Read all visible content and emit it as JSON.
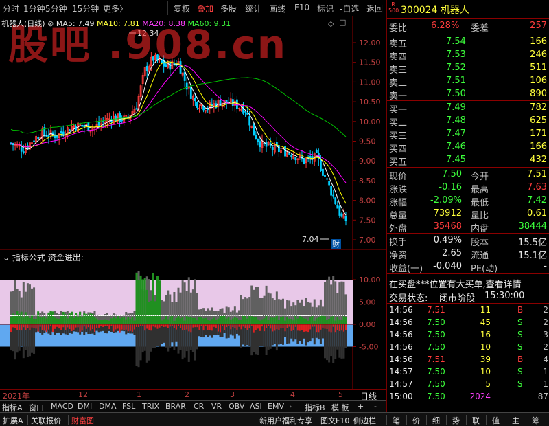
{
  "toolbar": {
    "items": [
      "分时",
      "1分钟",
      "5分钟",
      "15分钟",
      "更多〉",
      "复权",
      "叠加",
      "多股",
      "统计",
      "画线",
      "F10",
      "标记",
      "-自选",
      "返回"
    ],
    "active_index": 0
  },
  "watermark": "股吧 .908.cn",
  "main_chart": {
    "stock_label": "机器人(日线)",
    "ma5": "MA5: 7.49",
    "ma10": "MA10: 7.81",
    "ma20": "MA20: 8.38",
    "ma60": "MA60: 9.31",
    "high_label": "12.34",
    "low_label": "7.04",
    "fin_badge": "财",
    "y_ticks": [
      "12.00",
      "11.50",
      "11.00",
      "10.50",
      "10.00",
      "9.50",
      "9.00",
      "8.50",
      "8.00",
      "7.50",
      "7.00"
    ],
    "colors": {
      "ma5": "#ffffff",
      "ma10": "#ffff00",
      "ma20": "#ff00ff",
      "ma60": "#00c000",
      "up": "#ff3c3c",
      "down": "#00d0ff"
    }
  },
  "sub_chart": {
    "title": "指标公式 资金进出: -",
    "y_ticks": [
      "10.00",
      "5.00",
      "0.00",
      "-5.00"
    ]
  },
  "time_axis": [
    "2021年",
    "12",
    "1",
    "2",
    "3",
    "4",
    "5"
  ],
  "period_label": "日线",
  "indicator_tabs": [
    "指标A",
    "窗口",
    "MACD",
    "DMI",
    "DMA",
    "FSL",
    "TRIX",
    "BRAR",
    "CR",
    "VR",
    "OBV",
    "ASI",
    "EMV"
  ],
  "indicator_tabs_right": [
    "指标B",
    "模 板",
    "+",
    "-"
  ],
  "right_panel": {
    "code": "300024",
    "name": "机器人",
    "badge_top": "R",
    "badge_bottom": "500",
    "webi": {
      "label": "委比",
      "value": "6.28%",
      "label2": "委差",
      "value2": "257"
    },
    "asks": [
      {
        "label": "卖五",
        "price": "7.54",
        "vol": "166"
      },
      {
        "label": "卖四",
        "price": "7.53",
        "vol": "246"
      },
      {
        "label": "卖三",
        "price": "7.52",
        "vol": "511"
      },
      {
        "label": "卖二",
        "price": "7.51",
        "vol": "106"
      },
      {
        "label": "卖一",
        "price": "7.50",
        "vol": "890"
      }
    ],
    "bids": [
      {
        "label": "买一",
        "price": "7.49",
        "vol": "782"
      },
      {
        "label": "买二",
        "price": "7.48",
        "vol": "625"
      },
      {
        "label": "买三",
        "price": "7.47",
        "vol": "171"
      },
      {
        "label": "买四",
        "price": "7.46",
        "vol": "166"
      },
      {
        "label": "买五",
        "price": "7.45",
        "vol": "432"
      }
    ],
    "quote": [
      {
        "l1": "现价",
        "v1": "7.50",
        "l2": "今开",
        "v2": "7.51"
      },
      {
        "l1": "涨跌",
        "v1": "-0.16",
        "l2": "最高",
        "v2": "7.63"
      },
      {
        "l1": "涨幅",
        "v1": "-2.09%",
        "l2": "最低",
        "v2": "7.42"
      },
      {
        "l1": "总量",
        "v1": "73912",
        "l2": "量比",
        "v2": "0.61"
      },
      {
        "l1": "外盘",
        "v1": "35468",
        "l2": "内盘",
        "v2": "38444"
      }
    ],
    "fin": [
      {
        "l1": "换手",
        "v1": "0.49%",
        "l2": "股本",
        "v2": "15.5亿"
      },
      {
        "l1": "净资",
        "v1": "2.65",
        "l2": "流通",
        "v2": "15.1亿"
      },
      {
        "l1": "收益(一)",
        "v1": "-0.040",
        "l2": "PE(动)",
        "v2": "-"
      }
    ],
    "notice": "在买盘***位置有大买单,查看详情",
    "trade_status_label": "交易状态:",
    "trade_status_value": "闭市阶段",
    "trade_status_time": "15:30:00",
    "ticks": [
      {
        "time": "14:56",
        "price": "7.51",
        "vol": "11",
        "bs": "B",
        "n": "2"
      },
      {
        "time": "14:56",
        "price": "7.50",
        "vol": "45",
        "bs": "S",
        "n": "2"
      },
      {
        "time": "14:56",
        "price": "7.50",
        "vol": "16",
        "bs": "S",
        "n": "3"
      },
      {
        "time": "14:56",
        "price": "7.50",
        "vol": "10",
        "bs": "S",
        "n": "2"
      },
      {
        "time": "14:56",
        "price": "7.51",
        "vol": "39",
        "bs": "B",
        "n": "4"
      },
      {
        "time": "14:57",
        "price": "7.50",
        "vol": "10",
        "bs": "S",
        "n": "1"
      },
      {
        "time": "14:57",
        "price": "7.50",
        "vol": "5",
        "bs": "S",
        "n": "1"
      },
      {
        "time": "15:00",
        "price": "7.50",
        "vol": "2024",
        "bs": "",
        "n": "87"
      }
    ]
  },
  "status_bar": {
    "left": [
      "扩展A",
      "关联报价",
      "财富图"
    ],
    "middle": [
      "新用户福利专享",
      "图文F10",
      "侧边栏"
    ],
    "right": [
      "笔",
      "价",
      "细",
      "势",
      "联",
      "值",
      "主",
      "筹"
    ]
  }
}
